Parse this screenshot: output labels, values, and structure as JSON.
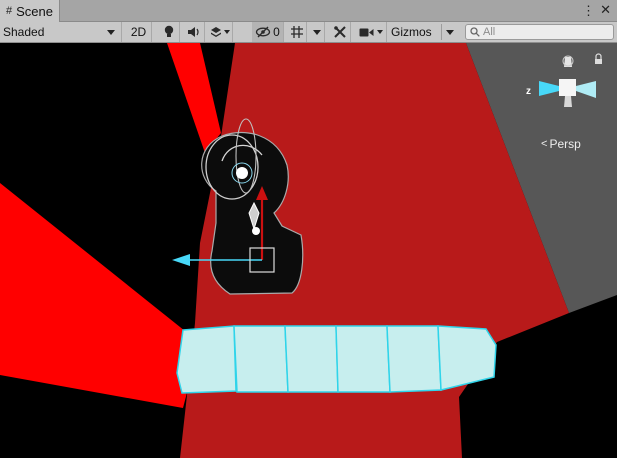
{
  "window": {
    "tab_title": "Scene",
    "tab_icon": "grid-hash-icon",
    "menu_glyph": "⋮",
    "close_glyph": "✕"
  },
  "toolbar": {
    "shading_mode": "Shaded",
    "toggle_2d": "2D",
    "light_icon": "lightbulb-icon",
    "audio_icon": "speaker-icon",
    "effects_icon": "layers-icon",
    "hidden_objects_icon": "eye-slash-icon",
    "hidden_count": "0",
    "grid_icon": "grid-icon",
    "tools_icon": "tools-icon",
    "camera_icon": "camera-icon",
    "gizmos_label": "Gizmos",
    "search_placeholder": "All",
    "search_value": ""
  },
  "scene_gizmo": {
    "projection_label": "Persp",
    "axis_z_label": "z",
    "lock_icon": "lock-icon"
  },
  "colors": {
    "tab_bg": "#c8c8c8",
    "toolbar_bg": "#c8c8c8",
    "floor_red": "#b81a1a",
    "ray_red": "#ff0000",
    "wall_gray": "#575757",
    "block_cyan": "#c7eeee",
    "gizmo_cyan": "#48d8f8",
    "move_arrow_red": "#cc1010"
  }
}
